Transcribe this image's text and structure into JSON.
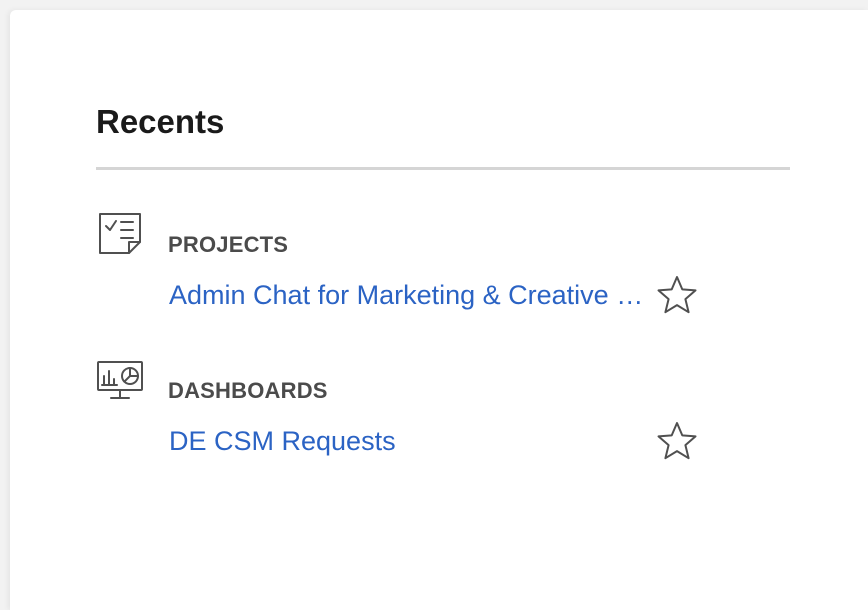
{
  "recents": {
    "title": "Recents",
    "sections": [
      {
        "label": "PROJECTS",
        "icon": "project-checklist-icon",
        "items": [
          {
            "name": "Admin Chat for Marketing & Creative Requests",
            "starred": false
          }
        ]
      },
      {
        "label": "DASHBOARDS",
        "icon": "dashboard-monitor-icon",
        "items": [
          {
            "name": "DE CSM Requests",
            "starred": false
          }
        ]
      }
    ]
  },
  "colors": {
    "link": "#2b63c4",
    "label": "#4b4b4b",
    "divider": "#d5d5d5",
    "icon": "#505050"
  }
}
